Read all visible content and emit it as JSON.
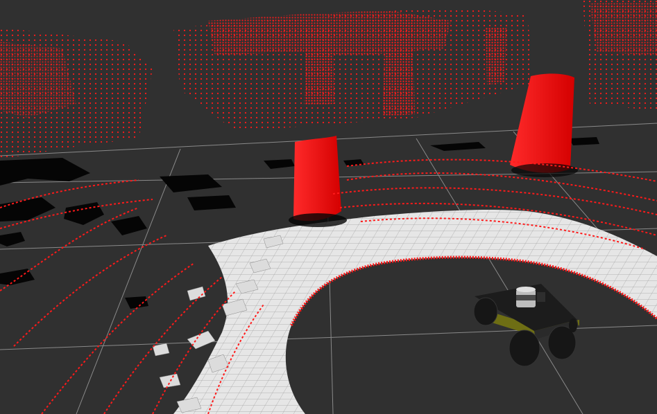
{
  "view": {
    "background": "#303030",
    "grid_color": "#a0a0a0",
    "pointcloud_color": "#ff1a1a",
    "occupied_color": "#050505",
    "free_color": "#e8e8e8"
  },
  "displays": {
    "grid": "grid-icon",
    "point_cloud": "lidar-pointcloud",
    "map": "occupancy-map",
    "robot_model": "robot-model"
  },
  "robot": {
    "body_color": "#1c1c1c",
    "accent_color": "#6e6e14",
    "wheel_color": "#161616",
    "sensor": "lidar-sensor-icon"
  }
}
